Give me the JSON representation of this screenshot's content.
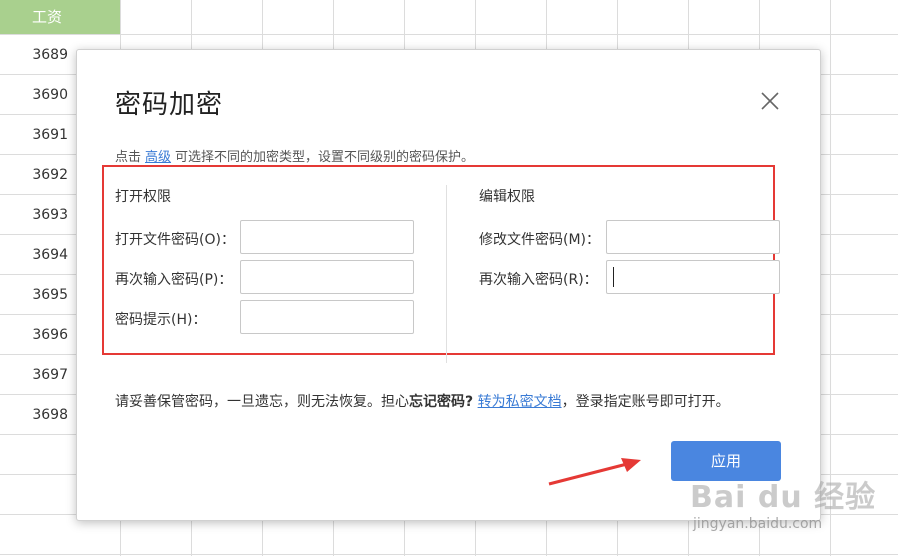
{
  "sheet": {
    "column_header": "工资",
    "row_numbers": [
      "3689",
      "3690",
      "3691",
      "3692",
      "3693",
      "3694",
      "3695",
      "3696",
      "3697",
      "3698"
    ]
  },
  "dialog": {
    "title": "密码加密",
    "hint_prefix": "点击",
    "hint_link": "高级",
    "hint_suffix": "可选择不同的加密类型，设置不同级别的密码保护。",
    "open_section": {
      "title": "打开权限",
      "password_label": "打开文件密码(O)：",
      "confirm_label": "再次输入密码(P)：",
      "hint_label": "密码提示(H)："
    },
    "edit_section": {
      "title": "编辑权限",
      "password_label": "修改文件密码(M)：",
      "confirm_label": "再次输入密码(R)："
    },
    "note_part1": "请妥善保管密码，一旦遗忘，则无法恢复。担心",
    "note_bold": "忘记密码?",
    "note_link": "转为私密文档",
    "note_part2": "，登录指定账号即可打开。",
    "apply_label": "应用"
  },
  "watermark": {
    "brand": "Bai du 经验",
    "url": "jingyan.baidu.com"
  },
  "colors": {
    "accent": "#4a86e0",
    "highlight_border": "#e53935",
    "header_fill": "#a9d08e"
  }
}
